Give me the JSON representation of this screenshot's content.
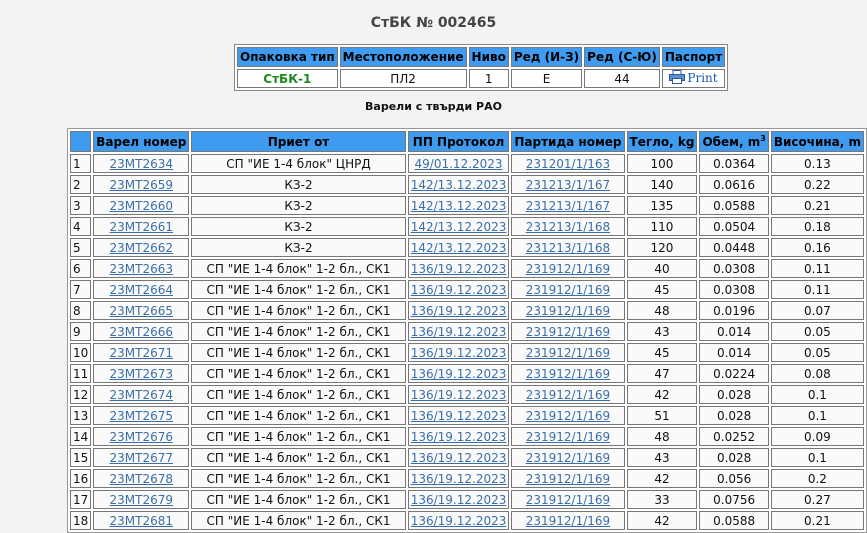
{
  "title": "СтБК № 002465",
  "package": {
    "headers": [
      "Опаковка тип",
      "Местоположение",
      "Ниво",
      "Ред (И-З)",
      "Ред (С-Ю)",
      "Паспорт"
    ],
    "type": "СтБК-1",
    "location": "ПЛ2",
    "level": "1",
    "row_ew": "Е",
    "row_ns": "44",
    "print_label": "Print",
    "print_icon": "printer-icon"
  },
  "section_title": "Варели с твърди РАО",
  "barrels": {
    "headers": {
      "num": "",
      "barrel": "Варел номер",
      "received": "Приет от",
      "protocol": "ПП Протокол",
      "batch": "Партида номер",
      "weight": "Тегло, kg",
      "volume": "Обем, m",
      "volume_sup": "3",
      "height": "Височина, m"
    },
    "rows": [
      {
        "n": "1",
        "barrel": "23MT2634",
        "received": "СП \"ИЕ 1-4 блок\" ЦНРД",
        "protocol": "49/01.12.2023",
        "batch": "231201/1/163",
        "weight": "100",
        "volume": "0.0364",
        "height": "0.13"
      },
      {
        "n": "2",
        "barrel": "23MT2659",
        "received": "КЗ-2",
        "protocol": "142/13.12.2023",
        "batch": "231213/1/167",
        "weight": "140",
        "volume": "0.0616",
        "height": "0.22"
      },
      {
        "n": "3",
        "barrel": "23MT2660",
        "received": "КЗ-2",
        "protocol": "142/13.12.2023",
        "batch": "231213/1/167",
        "weight": "135",
        "volume": "0.0588",
        "height": "0.21"
      },
      {
        "n": "4",
        "barrel": "23MT2661",
        "received": "КЗ-2",
        "protocol": "142/13.12.2023",
        "batch": "231213/1/168",
        "weight": "110",
        "volume": "0.0504",
        "height": "0.18"
      },
      {
        "n": "5",
        "barrel": "23MT2662",
        "received": "КЗ-2",
        "protocol": "142/13.12.2023",
        "batch": "231213/1/168",
        "weight": "120",
        "volume": "0.0448",
        "height": "0.16"
      },
      {
        "n": "6",
        "barrel": "23MT2663",
        "received": "СП \"ИЕ 1-4 блок\" 1-2 бл., СК1",
        "protocol": "136/19.12.2023",
        "batch": "231912/1/169",
        "weight": "40",
        "volume": "0.0308",
        "height": "0.11"
      },
      {
        "n": "7",
        "barrel": "23MT2664",
        "received": "СП \"ИЕ 1-4 блок\" 1-2 бл., СК1",
        "protocol": "136/19.12.2023",
        "batch": "231912/1/169",
        "weight": "45",
        "volume": "0.0308",
        "height": "0.11"
      },
      {
        "n": "8",
        "barrel": "23MT2665",
        "received": "СП \"ИЕ 1-4 блок\" 1-2 бл., СК1",
        "protocol": "136/19.12.2023",
        "batch": "231912/1/169",
        "weight": "48",
        "volume": "0.0196",
        "height": "0.07"
      },
      {
        "n": "9",
        "barrel": "23MT2666",
        "received": "СП \"ИЕ 1-4 блок\" 1-2 бл., СК1",
        "protocol": "136/19.12.2023",
        "batch": "231912/1/169",
        "weight": "43",
        "volume": "0.014",
        "height": "0.05"
      },
      {
        "n": "10",
        "barrel": "23MT2671",
        "received": "СП \"ИЕ 1-4 блок\" 1-2 бл., СК1",
        "protocol": "136/19.12.2023",
        "batch": "231912/1/169",
        "weight": "45",
        "volume": "0.014",
        "height": "0.05"
      },
      {
        "n": "11",
        "barrel": "23MT2673",
        "received": "СП \"ИЕ 1-4 блок\" 1-2 бл., СК1",
        "protocol": "136/19.12.2023",
        "batch": "231912/1/169",
        "weight": "47",
        "volume": "0.0224",
        "height": "0.08"
      },
      {
        "n": "12",
        "barrel": "23MT2674",
        "received": "СП \"ИЕ 1-4 блок\" 1-2 бл., СК1",
        "protocol": "136/19.12.2023",
        "batch": "231912/1/169",
        "weight": "42",
        "volume": "0.028",
        "height": "0.1"
      },
      {
        "n": "13",
        "barrel": "23MT2675",
        "received": "СП \"ИЕ 1-4 блок\" 1-2 бл., СК1",
        "protocol": "136/19.12.2023",
        "batch": "231912/1/169",
        "weight": "51",
        "volume": "0.028",
        "height": "0.1"
      },
      {
        "n": "14",
        "barrel": "23MT2676",
        "received": "СП \"ИЕ 1-4 блок\" 1-2 бл., СК1",
        "protocol": "136/19.12.2023",
        "batch": "231912/1/169",
        "weight": "48",
        "volume": "0.0252",
        "height": "0.09"
      },
      {
        "n": "15",
        "barrel": "23MT2677",
        "received": "СП \"ИЕ 1-4 блок\" 1-2 бл., СК1",
        "protocol": "136/19.12.2023",
        "batch": "231912/1/169",
        "weight": "43",
        "volume": "0.028",
        "height": "0.1"
      },
      {
        "n": "16",
        "barrel": "23MT2678",
        "received": "СП \"ИЕ 1-4 блок\" 1-2 бл., СК1",
        "protocol": "136/19.12.2023",
        "batch": "231912/1/169",
        "weight": "42",
        "volume": "0.056",
        "height": "0.2"
      },
      {
        "n": "17",
        "barrel": "23MT2679",
        "received": "СП \"ИЕ 1-4 блок\" 1-2 бл., СК1",
        "protocol": "136/19.12.2023",
        "batch": "231912/1/169",
        "weight": "33",
        "volume": "0.0756",
        "height": "0.27"
      },
      {
        "n": "18",
        "barrel": "23MT2681",
        "received": "СП \"ИЕ 1-4 блок\" 1-2 бл., СК1",
        "protocol": "136/19.12.2023",
        "batch": "231912/1/169",
        "weight": "42",
        "volume": "0.0588",
        "height": "0.21"
      }
    ]
  }
}
